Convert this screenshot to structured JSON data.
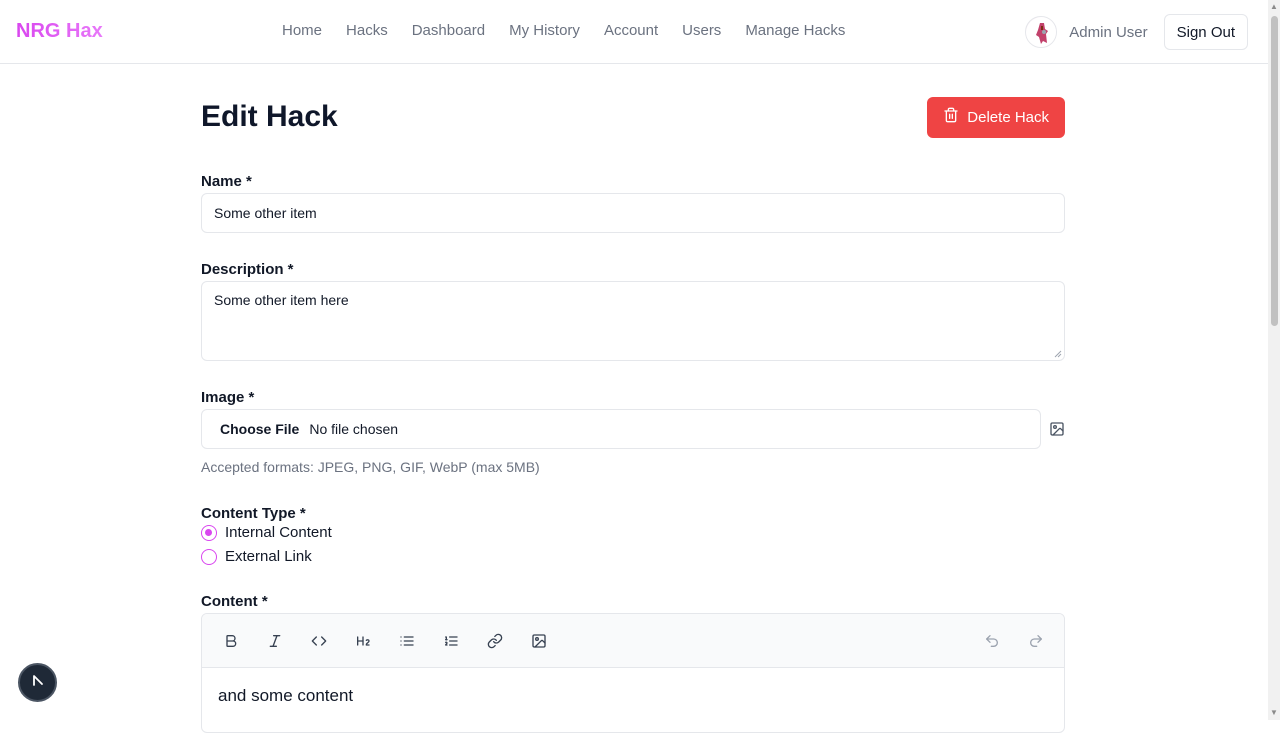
{
  "header": {
    "logo": "NRG Hax",
    "nav": [
      "Home",
      "Hacks",
      "Dashboard",
      "My History",
      "Account",
      "Users",
      "Manage Hacks"
    ],
    "user_name": "Admin User",
    "sign_out": "Sign Out"
  },
  "page": {
    "title": "Edit Hack",
    "delete_label": "Delete Hack"
  },
  "form": {
    "name_label": "Name *",
    "name_value": "Some other item",
    "description_label": "Description *",
    "description_value": "Some other item here",
    "image_label": "Image *",
    "file_button": "Choose File",
    "file_status": "No file chosen",
    "image_help": "Accepted formats: JPEG, PNG, GIF, WebP (max 5MB)",
    "content_type_label": "Content Type *",
    "content_type_options": [
      "Internal Content",
      "External Link"
    ],
    "content_type_selected": "Internal Content",
    "content_label": "Content *",
    "content_value": "and some content"
  },
  "colors": {
    "accent": "#d946ef",
    "danger": "#ef4444"
  },
  "icons": {
    "toolbar": [
      "bold-icon",
      "italic-icon",
      "code-icon",
      "heading-2-icon",
      "bullet-list-icon",
      "ordered-list-icon",
      "link-icon",
      "image-icon",
      "undo-icon",
      "redo-icon"
    ]
  }
}
